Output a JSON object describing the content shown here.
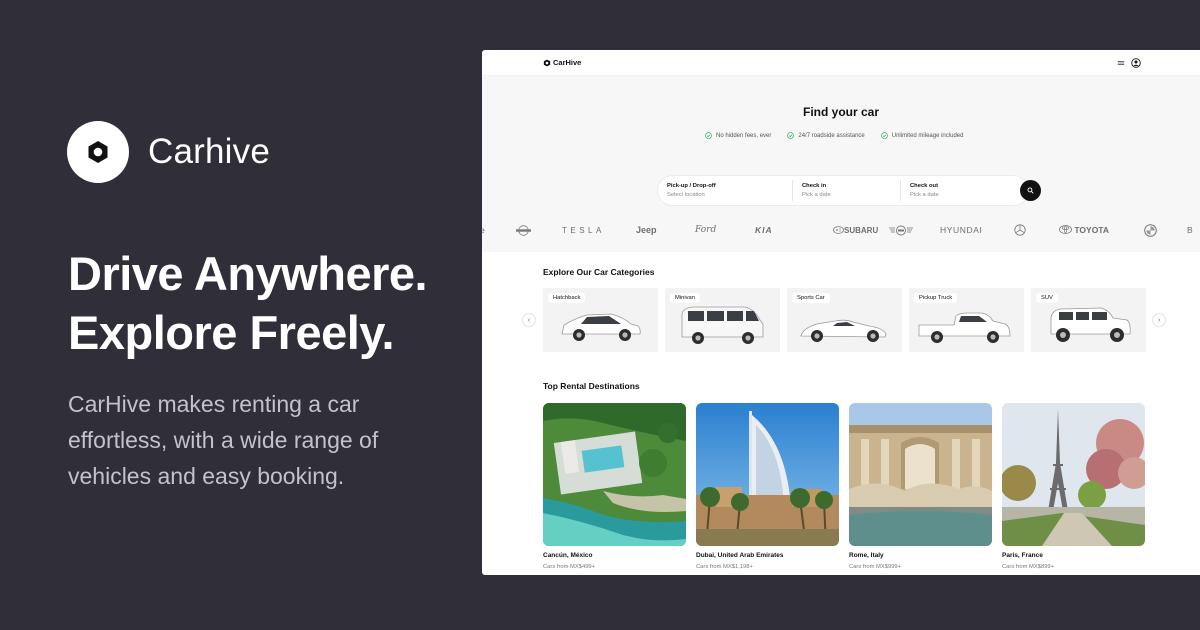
{
  "brand": {
    "name": "Carhive",
    "logo_icon": "hexagon-icon"
  },
  "hero": {
    "headline_line1": "Drive Anywhere.",
    "headline_line2": "Explore Freely.",
    "subcopy": "CarHive makes renting a car effortless, with a wide range of vehicles and easy booking."
  },
  "app": {
    "brand": "CarHive",
    "menu_icon": "menu-icon",
    "user_icon": "user-circle-icon",
    "search": {
      "title": "Find your car",
      "perks": [
        "No hidden fees, ever",
        "24/7 roadside assistance",
        "Unlimited mileage included"
      ],
      "fields": [
        {
          "label": "Pick-up / Drop-off",
          "placeholder": "Select location"
        },
        {
          "label": "Check in",
          "placeholder": "Pick a date"
        },
        {
          "label": "Check out",
          "placeholder": "Pick a date"
        }
      ]
    },
    "brands": [
      "TESLA",
      "Jeep",
      "Ford",
      "KIA",
      "SUBARU",
      "HYUNDAI",
      "TOYOTA"
    ],
    "categories_title": "Explore Our Car Categories",
    "categories": [
      "Hatchback",
      "Minivan",
      "Sports Car",
      "Pickup Truck",
      "SUV"
    ],
    "destinations_title": "Top Rental Destinations",
    "destinations": [
      {
        "name": "Cancún, México",
        "price": "Cars from MX$499+"
      },
      {
        "name": "Dubai, United Arab Emirates",
        "price": "Cars from MX$1,198+"
      },
      {
        "name": "Rome, Italy",
        "price": "Cars from MX$999+"
      },
      {
        "name": "Paris, France",
        "price": "Cars from MX$899+"
      }
    ]
  },
  "colors": {
    "background": "#302e38",
    "accent_check": "#2fa866",
    "text_light": "#c3c2ca"
  }
}
